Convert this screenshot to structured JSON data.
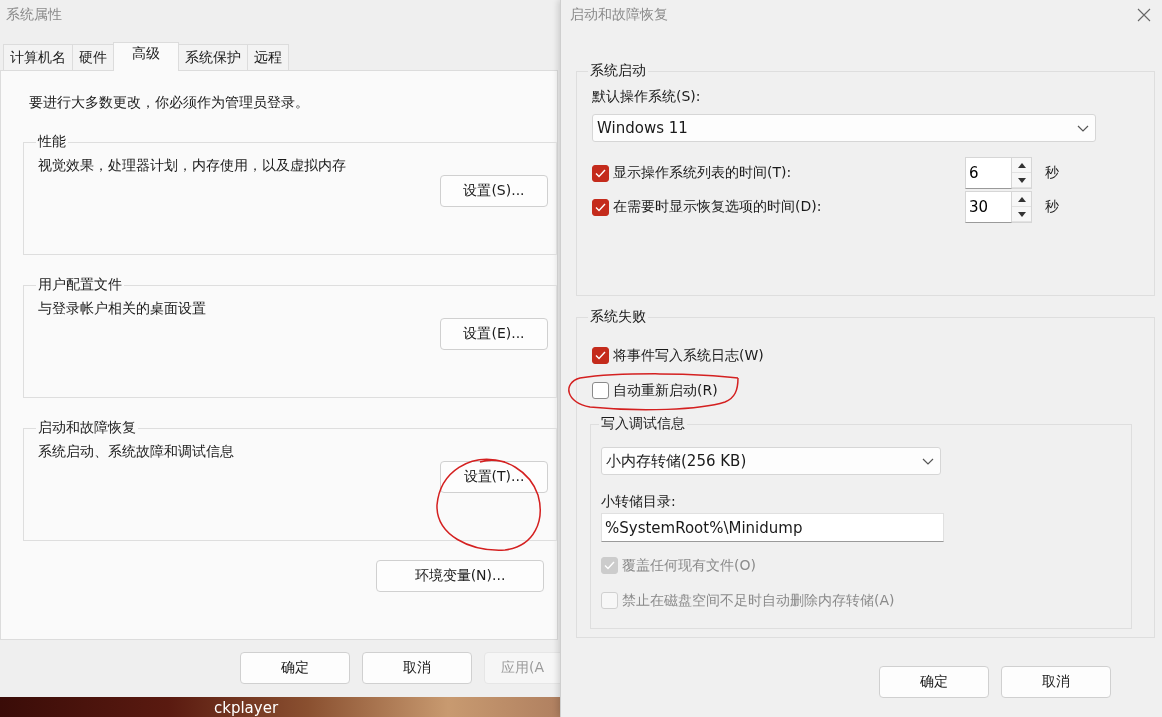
{
  "left_window": {
    "title": "系统属性",
    "tabs": [
      {
        "label": "计算机名",
        "selected": false
      },
      {
        "label": "硬件",
        "selected": false
      },
      {
        "label": "高级",
        "selected": true
      },
      {
        "label": "系统保护",
        "selected": false
      },
      {
        "label": "远程",
        "selected": false
      }
    ],
    "notice": "要进行大多数更改，你必须作为管理员登录。",
    "groups": [
      {
        "title": "性能",
        "description": "视觉效果，处理器计划，内存使用，以及虚拟内存",
        "button": "设置(S)..."
      },
      {
        "title": "用户配置文件",
        "description": "与登录帐户相关的桌面设置",
        "button": "设置(E)..."
      },
      {
        "title": "启动和故障恢复",
        "description": "系统启动、系统故障和调试信息",
        "button": "设置(T)..."
      }
    ],
    "env_button": "环境变量(N)...",
    "buttons": [
      {
        "label": "确定",
        "disabled": false
      },
      {
        "label": "取消",
        "disabled": false
      },
      {
        "label": "应用(A",
        "disabled": true
      }
    ]
  },
  "desktop": {
    "icon_label": "ckplayer"
  },
  "right_window": {
    "title": "启动和故障恢复",
    "startup": {
      "title": "系统启动",
      "default_os_label": "默认操作系统(S):",
      "default_os": "Windows 11",
      "timeouts": [
        {
          "label": "显示操作系统列表的时间(T):",
          "checked": true,
          "value": "6",
          "unit": "秒"
        },
        {
          "label": "在需要时显示恢复选项的时间(D):",
          "checked": true,
          "value": "30",
          "unit": "秒"
        }
      ]
    },
    "failure": {
      "title": "系统失败",
      "options": [
        {
          "label": "将事件写入系统日志(W)",
          "checked": true
        },
        {
          "label": "自动重新启动(R)",
          "checked": false
        }
      ],
      "debug": {
        "title": "写入调试信息",
        "dump_type": "小内存转储(256 KB)",
        "dir_label": "小转储目录:",
        "dir": "%SystemRoot%\\Minidump",
        "options": [
          {
            "label": "覆盖任何现有文件(O)",
            "checked": true,
            "disabled": true
          },
          {
            "label": "禁止在磁盘空间不足时自动删除内存转储(A)",
            "checked": false,
            "disabled": true
          }
        ]
      }
    },
    "buttons": [
      {
        "label": "确定",
        "disabled": false
      },
      {
        "label": "取消",
        "disabled": false
      }
    ]
  }
}
